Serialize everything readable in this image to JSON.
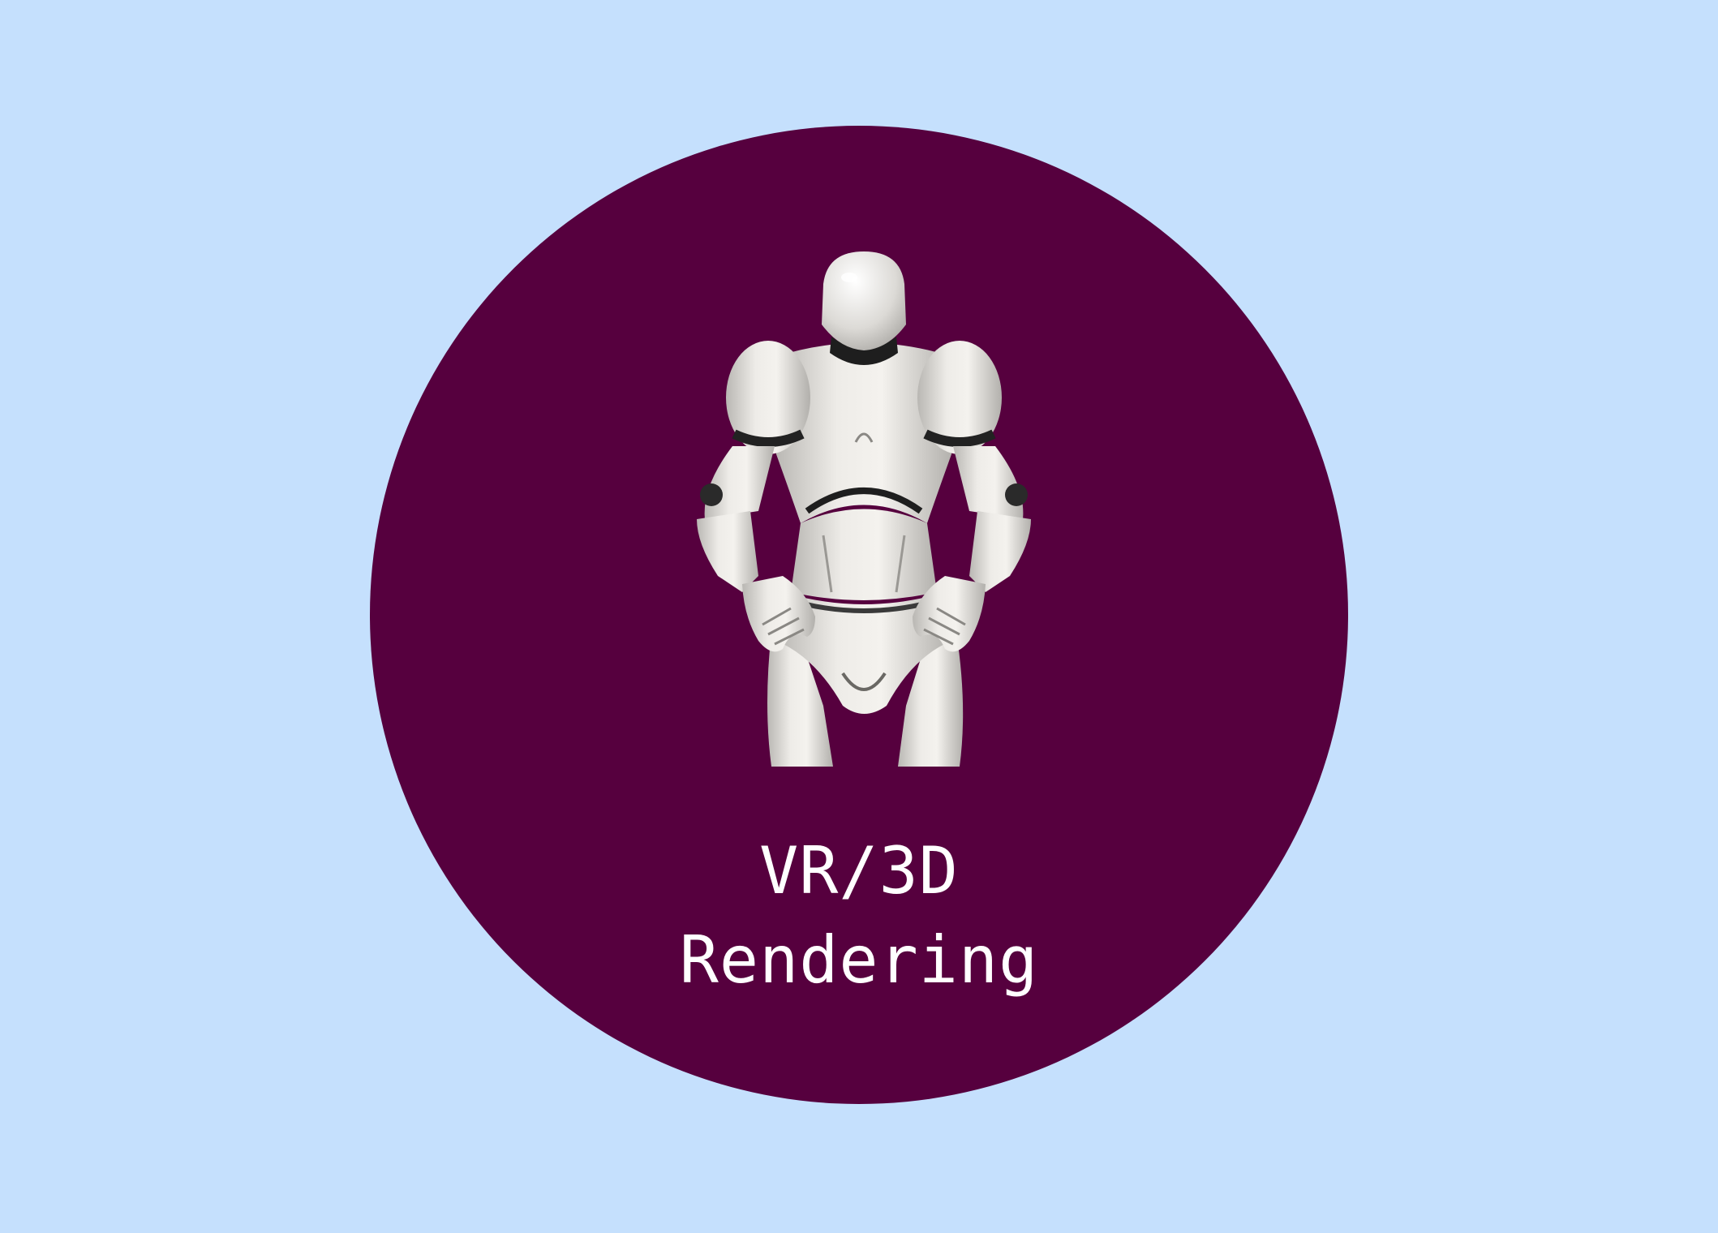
{
  "colors": {
    "background": "#c5e0fd",
    "badge": "#56003e",
    "caption": "#ffffff",
    "mannequin_body": "#e4e2de",
    "mannequin_joint": "#2a2a2a"
  },
  "badge": {
    "icon": "humanoid-mannequin-icon",
    "caption_lines": [
      "VR/3D",
      "Rendering"
    ]
  }
}
